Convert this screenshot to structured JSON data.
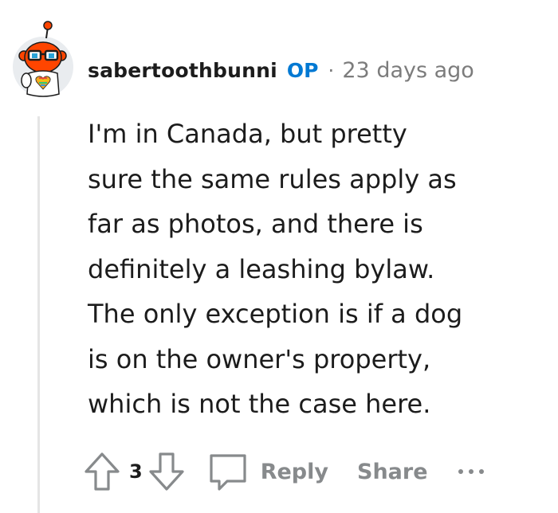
{
  "comment": {
    "author": "sabertoothbunni",
    "op_badge": "OP",
    "separator": "·",
    "timestamp": "23 days ago",
    "body": "I'm in Canada, but pretty\nsure the same rules apply as\nfar as photos, and there is\ndefinitely a leashing bylaw.\nThe only exception is if a dog\nis on the owner's property,\nwhich is not the case here.",
    "score": "3",
    "reply_label": "Reply",
    "share_label": "Share"
  },
  "icons": {
    "upvote": "upvote-arrow-icon",
    "downvote": "downvote-arrow-icon",
    "reply": "speech-bubble-icon",
    "more": "more-options-icon",
    "avatar": "snoo-avatar"
  },
  "colors": {
    "op_accent": "#0079d3",
    "avatar_orange": "#ff4500",
    "muted": "#878a8c",
    "text": "#1c1c1c"
  }
}
